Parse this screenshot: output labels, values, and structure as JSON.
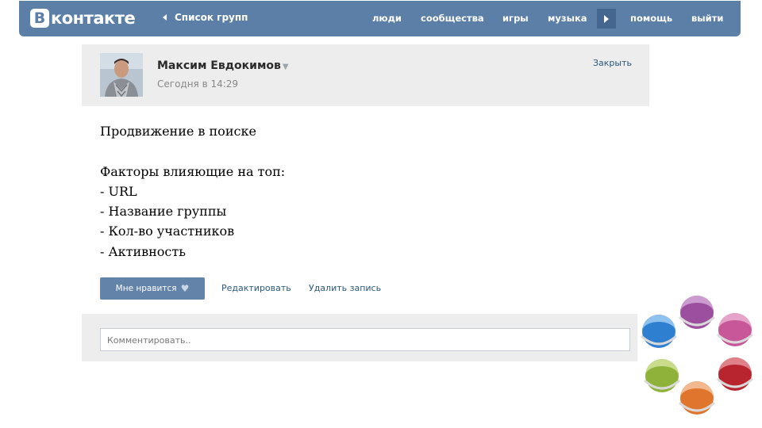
{
  "header": {
    "logo_letter": "B",
    "logo_text": "контакте",
    "back_link": "Список групп",
    "nav": [
      "люди",
      "сообщества",
      "игры",
      "музыка",
      "помощь",
      "выйти"
    ]
  },
  "post": {
    "author": "Максим Евдокимов",
    "time": "Сегодня в 14:29",
    "close_label": "Закрыть",
    "lines": [
      "Продвижение в поиске",
      "",
      "Факторы влияющие на топ:",
      "- URL",
      "- Название группы",
      "- Кол-во участников",
      "- Активность"
    ]
  },
  "actions": {
    "like_label": "Мне нравится",
    "edit_label": "Редактировать",
    "delete_label": "Удалить запись"
  },
  "comment": {
    "placeholder": "Комментировать.."
  },
  "colors": {
    "header_bg": "#5b7fa6",
    "accent_link": "#2b587a",
    "like_button": "#6383a8",
    "deco_blue": "#2f7fd0",
    "deco_purple": "#9b4f9e",
    "deco_pink": "#c8579a",
    "deco_red": "#b8252f",
    "deco_orange": "#e0762e",
    "deco_green": "#8fb33a"
  }
}
